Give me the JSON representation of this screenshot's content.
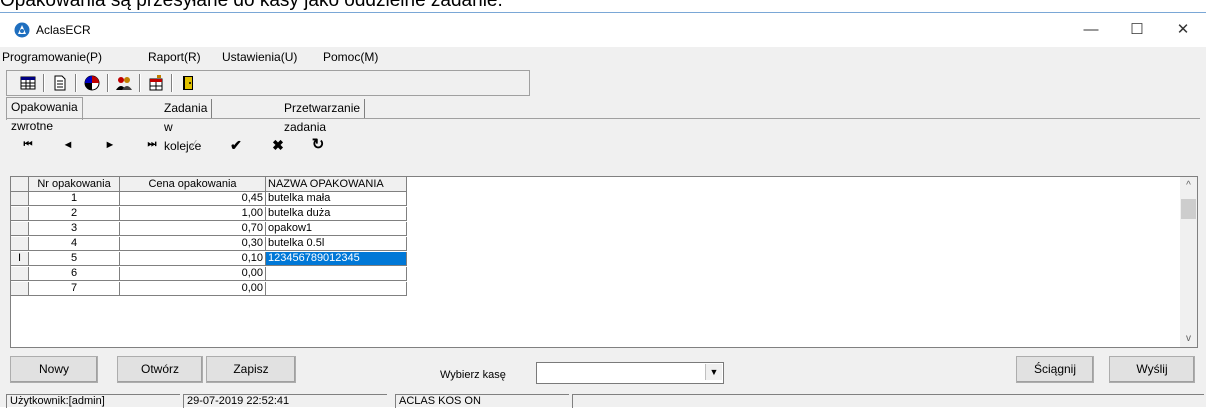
{
  "caption": "Opakowania są przesyłane do kasy jako oddzielne zadanie.",
  "window": {
    "title": "AclasECR",
    "controls": {
      "minimize": "—",
      "maximize": "☐",
      "close": "✕"
    }
  },
  "menu": [
    "Programowanie(P)",
    "Raport(R)",
    "Ustawienia(U)",
    "Pomoc(M)"
  ],
  "toolbar_icons": [
    "grid-view-icon",
    "document-icon",
    "color-palette-icon",
    "users-icon",
    "table-edit-icon",
    "exit-door-icon"
  ],
  "tabs": [
    "Opakowania zwrotne",
    "Zadania w kolejce",
    "Przetwarzanie zadania"
  ],
  "navigator": {
    "first": "⏮",
    "prior": "◄",
    "next": "►",
    "last": "⏭",
    "edit": "⁄",
    "post": "✔",
    "cancel": "✖",
    "refresh": "↻"
  },
  "grid": {
    "columns": [
      "Nr opakowania",
      "Cena opakowania",
      "NAZWA OPAKOWANIA"
    ],
    "current_row_marker": "I",
    "rows": [
      {
        "nr": "1",
        "price": "0,45",
        "name": "butelka mała"
      },
      {
        "nr": "2",
        "price": "1,00",
        "name": "butelka duża"
      },
      {
        "nr": "3",
        "price": "0,70",
        "name": "opakow1"
      },
      {
        "nr": "4",
        "price": "0,30",
        "name": "butelka 0.5l"
      },
      {
        "nr": "5",
        "price": "0,10",
        "name": "123456789012345"
      },
      {
        "nr": "6",
        "price": "0,00",
        "name": ""
      },
      {
        "nr": "7",
        "price": "0,00",
        "name": ""
      }
    ],
    "scroll": {
      "up": "^",
      "down": "v"
    }
  },
  "buttons": {
    "new": "Nowy",
    "open": "Otwórz",
    "save": "Zapisz",
    "download": "Ściągnij",
    "send": "Wyślij"
  },
  "register_select": {
    "label": "Wybierz kasę",
    "value": "",
    "arrow": "▼"
  },
  "status": {
    "user": "Użytkownik:[admin]",
    "datetime": "29-07-2019 22:52:41",
    "device": "ACLAS KOS ON"
  },
  "colors": {
    "selection": "#0078d7",
    "window_bg": "#f0f0f0"
  }
}
